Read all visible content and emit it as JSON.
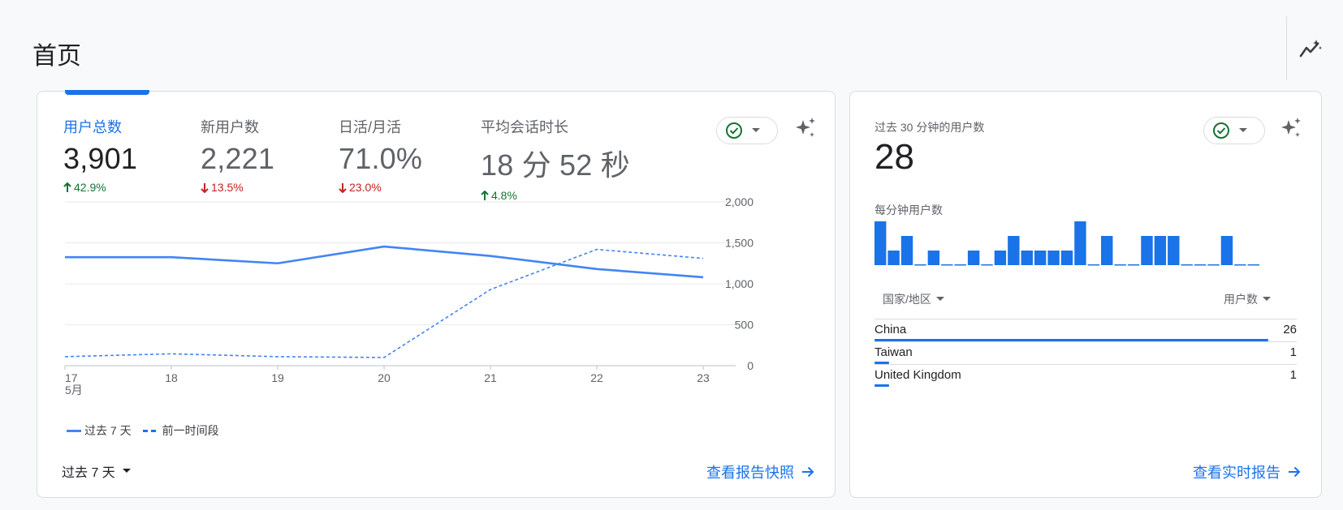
{
  "page_title": "首页",
  "colors": {
    "accent": "#1a73e8",
    "line": "#4285f4",
    "up": "#137333",
    "down": "#c5221f"
  },
  "main_card": {
    "metrics": [
      {
        "label": "用户总数",
        "value": "3,901",
        "delta": "42.9%",
        "direction": "up",
        "active": true
      },
      {
        "label": "新用户数",
        "value": "2,221",
        "delta": "13.5%",
        "direction": "down",
        "active": false
      },
      {
        "label": "日活/月活",
        "value": "71.0%",
        "delta": "23.0%",
        "direction": "down",
        "active": false
      },
      {
        "label": "平均会话时长",
        "value": "18 分 52 秒",
        "delta": "4.8%",
        "direction": "up",
        "active": false
      }
    ],
    "legend": {
      "current": "过去 7 天",
      "previous": "前一时间段"
    },
    "date_range": "过去 7 天",
    "view_link": "查看报告快照"
  },
  "chart_data": {
    "type": "line",
    "x": [
      "17",
      "18",
      "19",
      "20",
      "21",
      "22",
      "23"
    ],
    "x_sublabel": "5月",
    "ylim": [
      0,
      2000
    ],
    "yticks": [
      "0",
      "500",
      "1,000",
      "1,500",
      "2,000"
    ],
    "ytick_values": [
      0,
      500,
      1000,
      1500,
      2000
    ],
    "grid": true,
    "series": [
      {
        "name": "过去 7 天",
        "style": "solid",
        "values": [
          1325,
          1325,
          1250,
          1455,
          1340,
          1180,
          1080
        ]
      },
      {
        "name": "前一时间段",
        "style": "dashed",
        "values": [
          110,
          145,
          110,
          100,
          930,
          1420,
          1310
        ]
      }
    ]
  },
  "realtime_card": {
    "title": "过去 30 分钟的用户数",
    "value": "28",
    "per_minute_label": "每分钟用户数",
    "per_minute": [
      3,
      1,
      2,
      0,
      1,
      0,
      0,
      1,
      0,
      1,
      2,
      1,
      1,
      1,
      1,
      3,
      0,
      2,
      0,
      0,
      2,
      2,
      2,
      0,
      0,
      0,
      2,
      0,
      0
    ],
    "col_country": "国家/地区",
    "col_users": "用户数",
    "rows": [
      {
        "name": "China",
        "value": "26",
        "share": 1.0
      },
      {
        "name": "Taiwan",
        "value": "1",
        "share": 0.038
      },
      {
        "name": "United Kingdom",
        "value": "1",
        "share": 0.038
      }
    ],
    "view_link": "查看实时报告"
  }
}
